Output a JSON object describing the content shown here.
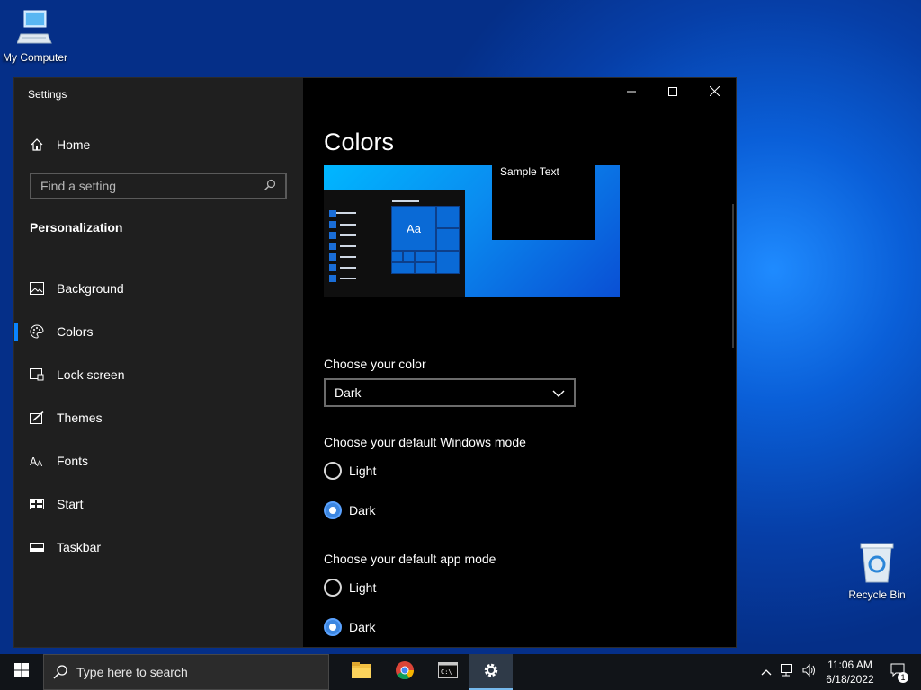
{
  "desktop": {
    "my_computer_label": "My Computer",
    "recycle_bin_label": "Recycle Bin"
  },
  "window": {
    "title": "Settings"
  },
  "sidebar": {
    "home_label": "Home",
    "search_placeholder": "Find a setting",
    "section_title": "Personalization",
    "items": [
      {
        "label": "Background",
        "icon": "background-icon"
      },
      {
        "label": "Colors",
        "icon": "palette-icon",
        "selected": true
      },
      {
        "label": "Lock screen",
        "icon": "lock-screen-icon"
      },
      {
        "label": "Themes",
        "icon": "themes-icon"
      },
      {
        "label": "Fonts",
        "icon": "fonts-icon"
      },
      {
        "label": "Start",
        "icon": "start-icon"
      },
      {
        "label": "Taskbar",
        "icon": "taskbar-icon"
      }
    ]
  },
  "main": {
    "title": "Colors",
    "preview_sample_text": "Sample Text",
    "preview_tile_text": "Aa",
    "choose_color_label": "Choose your color",
    "choose_color_value": "Dark",
    "windows_mode_label": "Choose your default Windows mode",
    "windows_mode_options": [
      "Light",
      "Dark"
    ],
    "windows_mode_selected": "Dark",
    "app_mode_label": "Choose your default app mode",
    "app_mode_options": [
      "Light",
      "Dark"
    ],
    "app_mode_selected": "Dark"
  },
  "taskbar": {
    "search_placeholder": "Type here to search",
    "time": "11:06 AM",
    "date": "6/18/2022",
    "notification_count": "1"
  },
  "colors": {
    "accent": "#0a84ff",
    "sidebar_bg": "#1f1f1f",
    "content_bg": "#000000"
  }
}
